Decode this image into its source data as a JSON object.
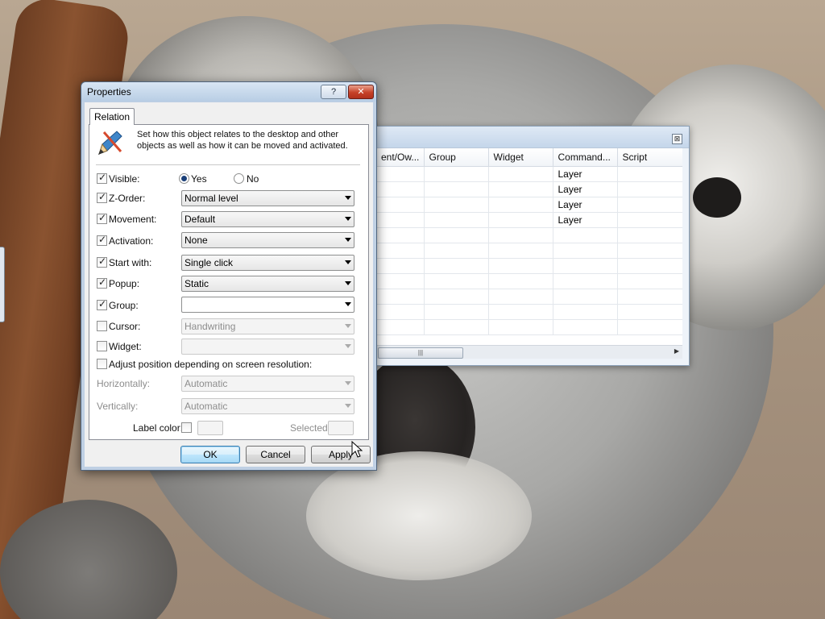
{
  "grid_window": {
    "columns": [
      "ent/Ow...",
      "Group",
      "Widget",
      "Command...",
      "Script"
    ],
    "rows": [
      [
        "",
        "",
        "",
        "Layer",
        ""
      ],
      [
        "",
        "",
        "",
        "Layer",
        ""
      ],
      [
        "",
        "",
        "",
        "Layer",
        ""
      ],
      [
        "",
        "",
        "",
        "Layer",
        ""
      ],
      [
        "",
        "",
        "",
        "",
        ""
      ],
      [
        "",
        "",
        "",
        "",
        ""
      ],
      [
        "",
        "",
        "",
        "",
        ""
      ],
      [
        "",
        "",
        "",
        "",
        ""
      ],
      [
        "",
        "",
        "",
        "",
        ""
      ],
      [
        "",
        "",
        "",
        "",
        ""
      ],
      [
        "",
        "",
        "",
        "",
        ""
      ]
    ],
    "close_glyph": "⊠",
    "scroll_thumb_glyph": "|||",
    "scroll_right_glyph": "▶"
  },
  "dialog": {
    "title": "Properties",
    "help_glyph": "?",
    "close_glyph": "✕",
    "tab": "Relation",
    "description": "Set how this object relates to the desktop and other objects as well as how it can be moved and activated.",
    "visible": {
      "label": "Visible:",
      "checked": true,
      "yes": "Yes",
      "no": "No",
      "selected": "Yes"
    },
    "zorder": {
      "label": "Z-Order:",
      "checked": true,
      "value": "Normal level"
    },
    "movement": {
      "label": "Movement:",
      "checked": true,
      "value": "Default"
    },
    "activation": {
      "label": "Activation:",
      "checked": true,
      "value": "None"
    },
    "startwith": {
      "label": "Start with:",
      "checked": true,
      "value": "Single click"
    },
    "popup": {
      "label": "Popup:",
      "checked": true,
      "value": "Static"
    },
    "group": {
      "label": "Group:",
      "checked": true,
      "value": ""
    },
    "cursor": {
      "label": "Cursor:",
      "checked": false,
      "value": "Handwriting"
    },
    "widget": {
      "label": "Widget:",
      "checked": false,
      "value": ""
    },
    "adjust": {
      "label": "Adjust position depending on screen resolution:",
      "checked": false
    },
    "horizontally": {
      "label": "Horizontally:",
      "value": "Automatic"
    },
    "vertically": {
      "label": "Vertically:",
      "value": "Automatic"
    },
    "label_color": {
      "label": "Label color:",
      "checked": false
    },
    "selected_label": "Selected",
    "buttons": {
      "ok": "OK",
      "cancel": "Cancel",
      "apply": "Apply"
    },
    "check_glyph": "✓"
  },
  "colors": {
    "accent": "#1a3f78",
    "close_red": "#c64128",
    "titlebar": "#c5d6ea"
  }
}
